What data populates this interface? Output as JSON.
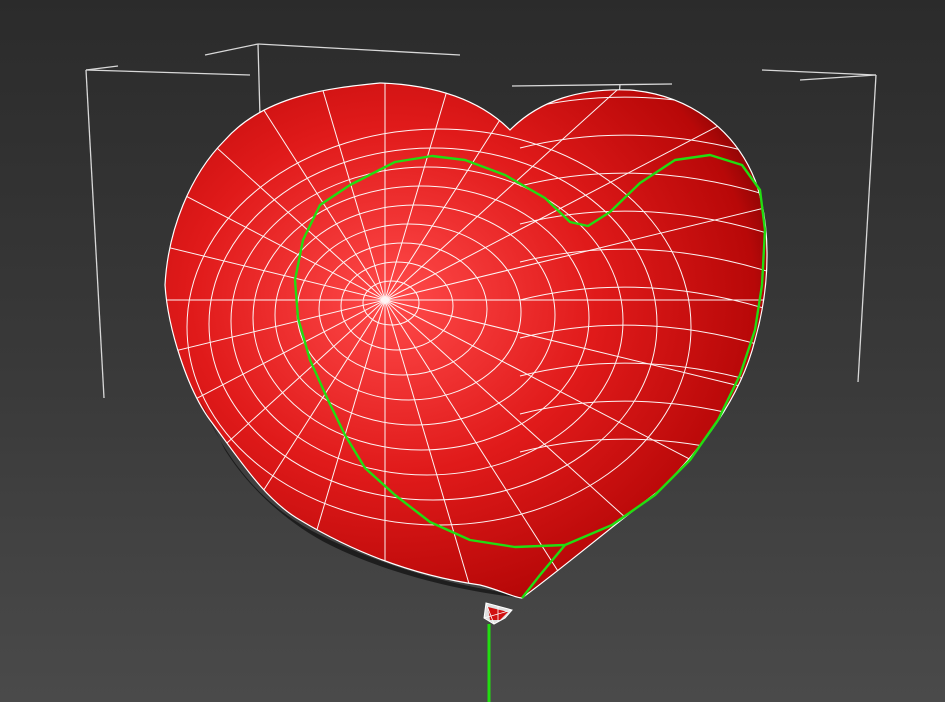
{
  "viewport": {
    "background_top": "#2b2b2b",
    "background_bottom": "#4a4a4a"
  },
  "model": {
    "object": "heart-balloon",
    "surface_color": "#e01a1a",
    "surface_highlight": "#ff4a4a",
    "surface_shadow": "#3a0000",
    "wireframe_color": "#ffffff",
    "selected_edge_color": "#22dd11"
  },
  "bounding_box": {
    "color": "#d8d8d8"
  },
  "string": {
    "color": "#22dd11"
  }
}
